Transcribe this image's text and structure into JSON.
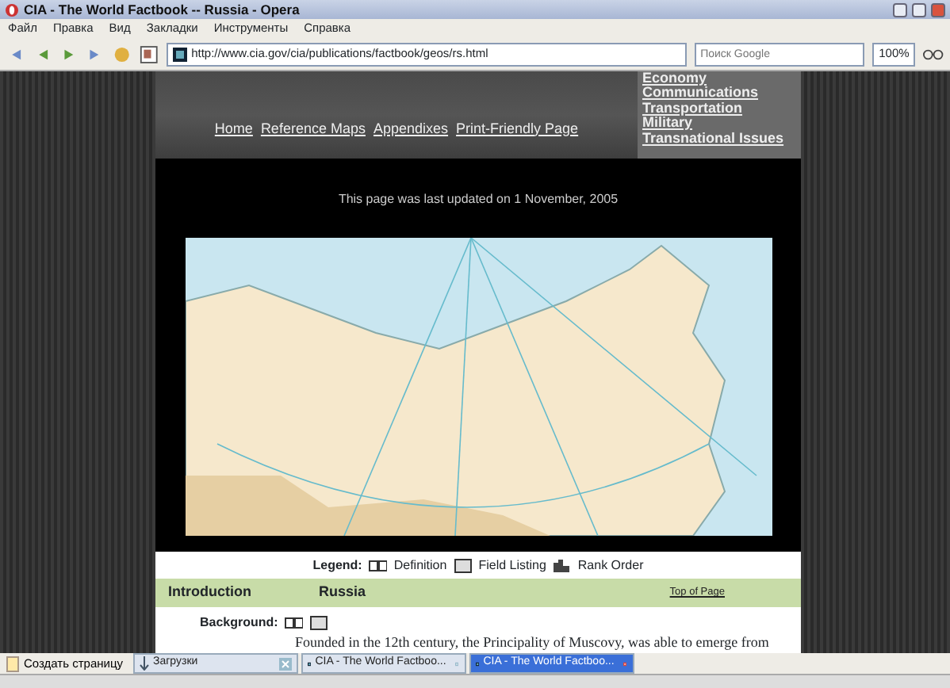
{
  "window": {
    "title": "CIA - The World Factbook -- Russia - Opera"
  },
  "menu": [
    "Файл",
    "Правка",
    "Вид",
    "Закладки",
    "Инструменты",
    "Справка"
  ],
  "toolbar": {
    "address": "http://www.cia.gov/cia/publications/factbook/geos/rs.html",
    "search": {
      "placeholder": "Поиск Google"
    },
    "zoom": "100%"
  },
  "page": {
    "nav_links": [
      "Home",
      "Reference Maps",
      "Appendixes",
      "Print-Friendly Page"
    ],
    "side_links": [
      "Economy",
      "Communications",
      "Transportation",
      "Military",
      "Transnational Issues"
    ],
    "updated": "This page was last updated on 1 November, 2005",
    "legend": {
      "title": "Legend:",
      "items": [
        {
          "kind": "definition",
          "label": "Definition"
        },
        {
          "kind": "field",
          "label": "Field Listing"
        },
        {
          "kind": "rank",
          "label": "Rank Order"
        }
      ]
    },
    "section": {
      "title": "Introduction",
      "country": "Russia",
      "top_link": "Top of Page"
    },
    "field": {
      "label": "Background:",
      "text": "Founded in the 12th century, the Principality of Muscovy, was able to emerge from"
    }
  },
  "new_page": "Создать страницу",
  "tabs": [
    {
      "kind": "downloads",
      "label": "Загрузки",
      "selected": false
    },
    {
      "kind": "page",
      "label": "CIA - The World Factboo...",
      "selected": false
    },
    {
      "kind": "page",
      "label": "CIA - The World Factboo...",
      "selected": true
    }
  ]
}
